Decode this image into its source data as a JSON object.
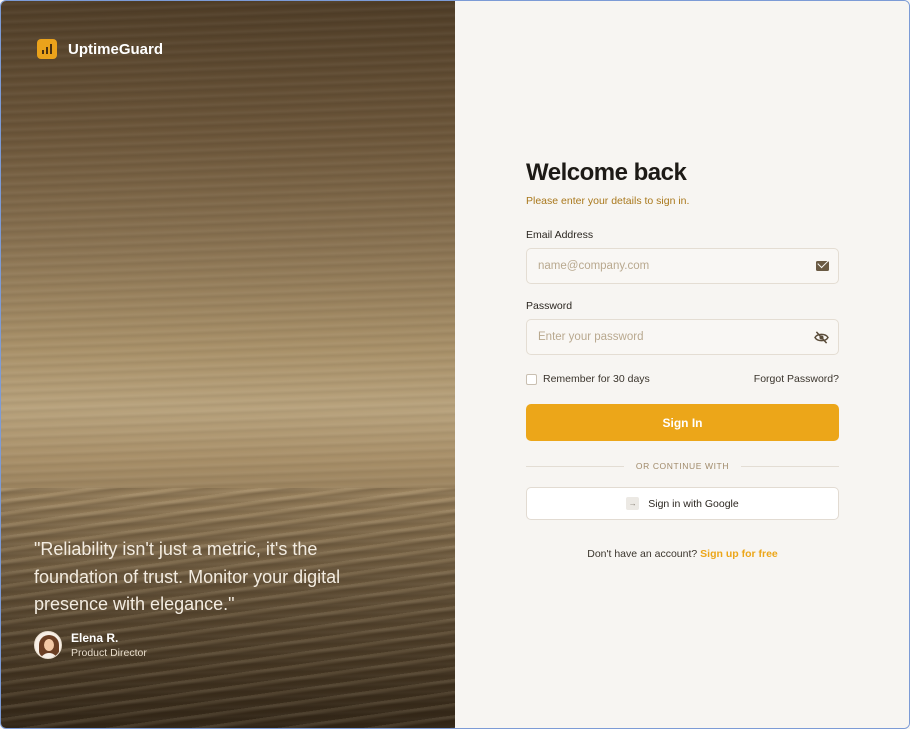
{
  "brand": {
    "name": "UptimeGuard",
    "icon": "bar-chart-icon"
  },
  "hero": {
    "quote": "\"Reliability isn't just a metric, it's the foundation of trust. Monitor your digital presence with elegance.\"",
    "author_name": "Elena R.",
    "author_role": "Product Director"
  },
  "form": {
    "title": "Welcome back",
    "subtitle": "Please enter your details to sign in.",
    "email": {
      "label": "Email Address",
      "placeholder": "name@company.com",
      "value": "",
      "icon": "mail-icon"
    },
    "password": {
      "label": "Password",
      "placeholder": "Enter your password",
      "value": "",
      "icon": "eye-off-icon"
    },
    "remember_label": "Remember for 30 days",
    "remember_checked": false,
    "forgot_label": "Forgot Password?",
    "signin_label": "Sign In",
    "divider_label": "OR CONTINUE WITH",
    "google_label": "Sign in with Google",
    "signup_prompt": "Don't have an account?",
    "signup_link": "Sign up for free"
  },
  "colors": {
    "accent": "#eca619",
    "accent_text": "#a9781c"
  }
}
